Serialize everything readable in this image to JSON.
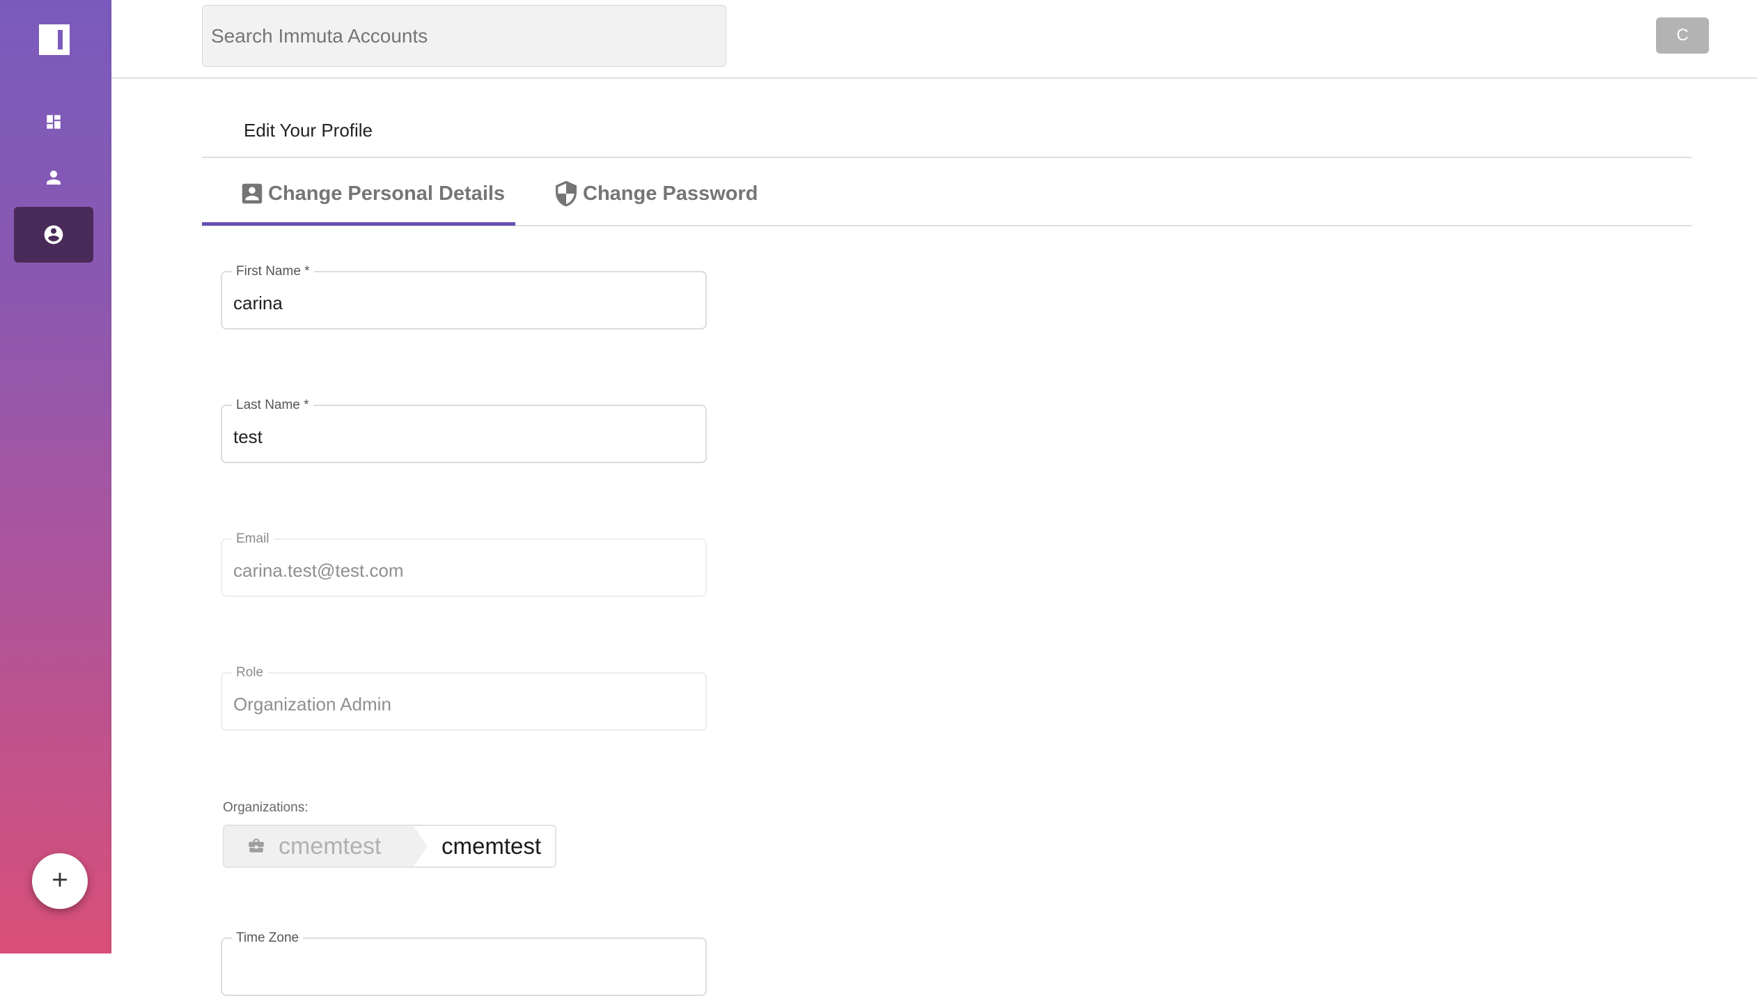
{
  "sidebar": {
    "logo": "immuta-logo",
    "items": [
      {
        "name": "dashboard",
        "icon": "dashboard-icon",
        "active": false
      },
      {
        "name": "users",
        "icon": "person-icon",
        "active": false
      },
      {
        "name": "profile",
        "icon": "account-circle-icon",
        "active": true
      }
    ],
    "fab": {
      "icon": "plus-icon"
    }
  },
  "header": {
    "search_placeholder": "Search Immuta Accounts",
    "search_value": "",
    "avatar_initial": "C"
  },
  "page": {
    "title": "Edit Your Profile",
    "tabs": [
      {
        "label": "Change Personal Details",
        "icon": "account-box-icon",
        "active": true
      },
      {
        "label": "Change Password",
        "icon": "shield-icon",
        "active": false
      }
    ]
  },
  "form": {
    "first_name": {
      "label": "First Name *",
      "value": "carina"
    },
    "last_name": {
      "label": "Last Name *",
      "value": "test"
    },
    "email": {
      "label": "Email",
      "value": "carina.test@test.com",
      "disabled": true
    },
    "role": {
      "label": "Role",
      "value": "Organization Admin",
      "disabled": true
    },
    "organizations": {
      "label": "Organizations:",
      "items": [
        {
          "parent": "cmemtest",
          "name": "cmemtest",
          "icon": "briefcase-icon"
        }
      ]
    },
    "time_zone": {
      "label": "Time Zone",
      "value": ""
    }
  },
  "colors": {
    "accent": "#6a4fb5",
    "sidebar_top": "#7a5bbd",
    "sidebar_bottom": "#d94f78",
    "active_nav": "#4a2a58"
  }
}
